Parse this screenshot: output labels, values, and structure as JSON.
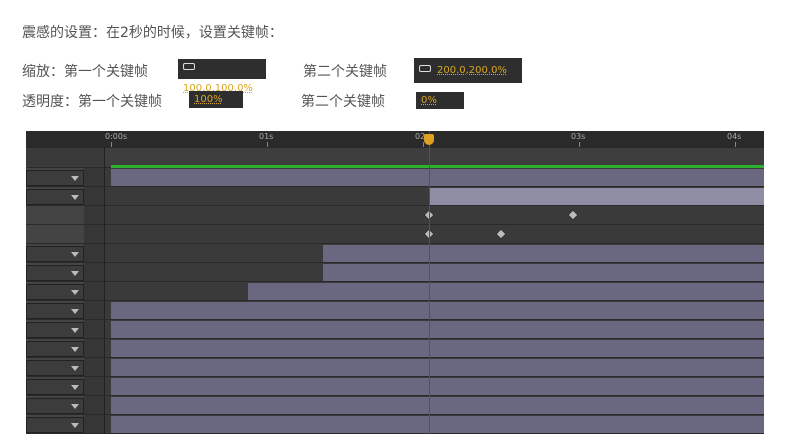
{
  "heading": "震感的设置：在2秒的时候，设置关键帧：",
  "scale": {
    "label": "缩放：第一个关键帧",
    "value1": "100.0,100.0%",
    "label2": "第二个关键帧",
    "value2": "200.0,200.0%",
    "icon": "link-icon"
  },
  "opacity": {
    "label": "透明度：第一个关键帧",
    "value1": "100%",
    "label2": "第二个关键帧",
    "value2": "0%"
  },
  "timeline": {
    "ticks": [
      {
        "label": "0:00s",
        "t": 0
      },
      {
        "label": "01s",
        "t": 1
      },
      {
        "label": "02s",
        "t": 2
      },
      {
        "label": "03s",
        "t": 3
      },
      {
        "label": "04s",
        "t": 4
      }
    ],
    "playhead_seconds": 2.04,
    "colors": {
      "playhead": "#c8201e",
      "work_area": "#2db02d",
      "bar": "#6a6880"
    },
    "rows": [
      {
        "dropdown": true,
        "bar_start": 0
      },
      {
        "dropdown": true,
        "bar_start": 2.04,
        "light": true
      },
      {
        "dropdown": false,
        "keyframes": [
          2.04,
          2.96
        ]
      },
      {
        "dropdown": false,
        "keyframes": [
          2.04,
          2.5
        ]
      },
      {
        "dropdown": true,
        "bar_start": 1.36
      },
      {
        "dropdown": true,
        "bar_start": 1.36
      },
      {
        "dropdown": true,
        "bar_start": 0.88
      },
      {
        "dropdown": true,
        "bar_start": 0
      },
      {
        "dropdown": true,
        "bar_start": 0
      },
      {
        "dropdown": true,
        "bar_start": 0
      },
      {
        "dropdown": true,
        "bar_start": 0
      },
      {
        "dropdown": true,
        "bar_start": 0
      },
      {
        "dropdown": true,
        "bar_start": 0
      },
      {
        "dropdown": true,
        "bar_start": 0
      }
    ]
  }
}
